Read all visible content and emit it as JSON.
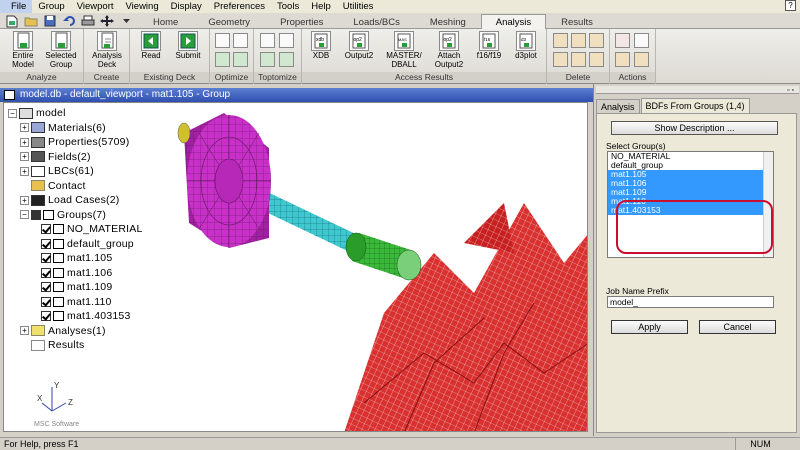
{
  "menu": [
    "File",
    "Group",
    "Viewport",
    "Viewing",
    "Display",
    "Preferences",
    "Tools",
    "Help",
    "Utilities"
  ],
  "tabs": [
    "Home",
    "Geometry",
    "Properties",
    "Loads/BCs",
    "Meshing",
    "Analysis",
    "Results"
  ],
  "active_tab": "Analysis",
  "ribbon": {
    "analyze": {
      "label": "Analyze",
      "b1": "Entire Model",
      "b2": "Selected Group"
    },
    "create": {
      "label": "Create",
      "b1": "Analysis Deck"
    },
    "existing": {
      "label": "Existing Deck",
      "b1": "Read",
      "b2": "Submit"
    },
    "optimize": {
      "label": "Optimize"
    },
    "toptomize": {
      "label": "Toptomize"
    },
    "access": {
      "label": "Access Results",
      "b1": "XDB",
      "b2": "Output2",
      "b3": "MASTER/ DBALL",
      "b4": "Attach Output2",
      "b5": "f16/f19",
      "b6": "d3plot"
    },
    "delete": {
      "label": "Delete"
    },
    "actions": {
      "label": "Actions"
    }
  },
  "viewport": {
    "title": "model.db - default_viewport - mat1.105 - Group",
    "tree": {
      "model": "model",
      "materials": "Materials(6)",
      "properties": "Properties(5709)",
      "fields": "Fields(2)",
      "lbcs": "LBCs(61)",
      "contact": "Contact",
      "loadcases": "Load Cases(2)",
      "groups": "Groups(7)",
      "g0": "NO_MATERIAL",
      "g1": "default_group",
      "g2": "mat1.105",
      "g3": "mat1.106",
      "g4": "mat1.109",
      "g5": "mat1.110",
      "g6": "mat1.403153",
      "analyses": "Analyses(1)",
      "results": "Results"
    },
    "axes": {
      "x": "X",
      "y": "Y",
      "z": "Z"
    }
  },
  "panel": {
    "tab1": "Analysis",
    "tab2": "BDFs From Groups (1,4)",
    "show_desc": "Show Description ...",
    "select_label": "Select Group(s)",
    "groups": [
      "NO_MATERIAL",
      "default_group",
      "mat1.105",
      "mat1.106",
      "mat1.109",
      "mat1.110",
      "mat1.403153"
    ],
    "selected": [
      2,
      3,
      4,
      5,
      6
    ],
    "job_label": "Job Name Prefix",
    "job_value": "model_",
    "apply": "Apply",
    "cancel": "Cancel"
  },
  "status": {
    "help": "For Help, press F1",
    "num": "NUM"
  },
  "colors": {
    "accent": "#3399ff",
    "highlight": "#c8102e",
    "wheel": "#c930c9",
    "shaft": "#40c8d0",
    "collar": "#3ab83a",
    "blades": "#d93030"
  }
}
